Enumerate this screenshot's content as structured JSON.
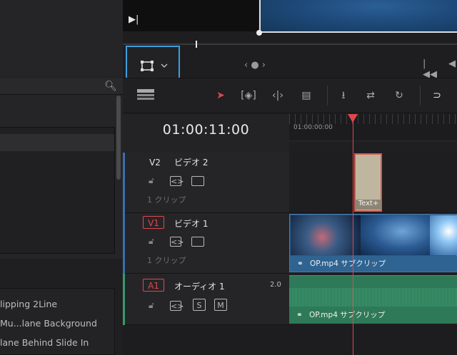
{
  "effects_list": {
    "items": [
      "lipping 2Line",
      "Mu...lane Background",
      "lane Behind Slide In"
    ]
  },
  "viewer": {
    "nav_label": "‹ ● ›"
  },
  "timeline": {
    "timecode": "01:00:11:00",
    "ruler_start": "01:00:00:00",
    "tracks": [
      {
        "id": "V2",
        "name": "ビデオ 2",
        "clip_count": "1 クリップ"
      },
      {
        "id": "V1",
        "name": "ビデオ 1",
        "clip_count": "1 クリップ"
      },
      {
        "id": "A1",
        "name": "オーディオ 1",
        "level": "2.0"
      }
    ],
    "clips": {
      "text_clip_label": "Text+",
      "video_clip_label": "OP.mp4 サブクリップ",
      "audio_clip_label": "OP.mp4 サブクリップ"
    },
    "solo_label": "S",
    "mute_label": "M"
  },
  "colors": {
    "accent": "#3aa0e0",
    "playhead": "#e0474c",
    "video_clip": "#2a5a86",
    "audio_clip": "#2e7a58",
    "audio_track_stripe": "#3a9a6a",
    "video_track_stripe": "#3a6fb0"
  }
}
